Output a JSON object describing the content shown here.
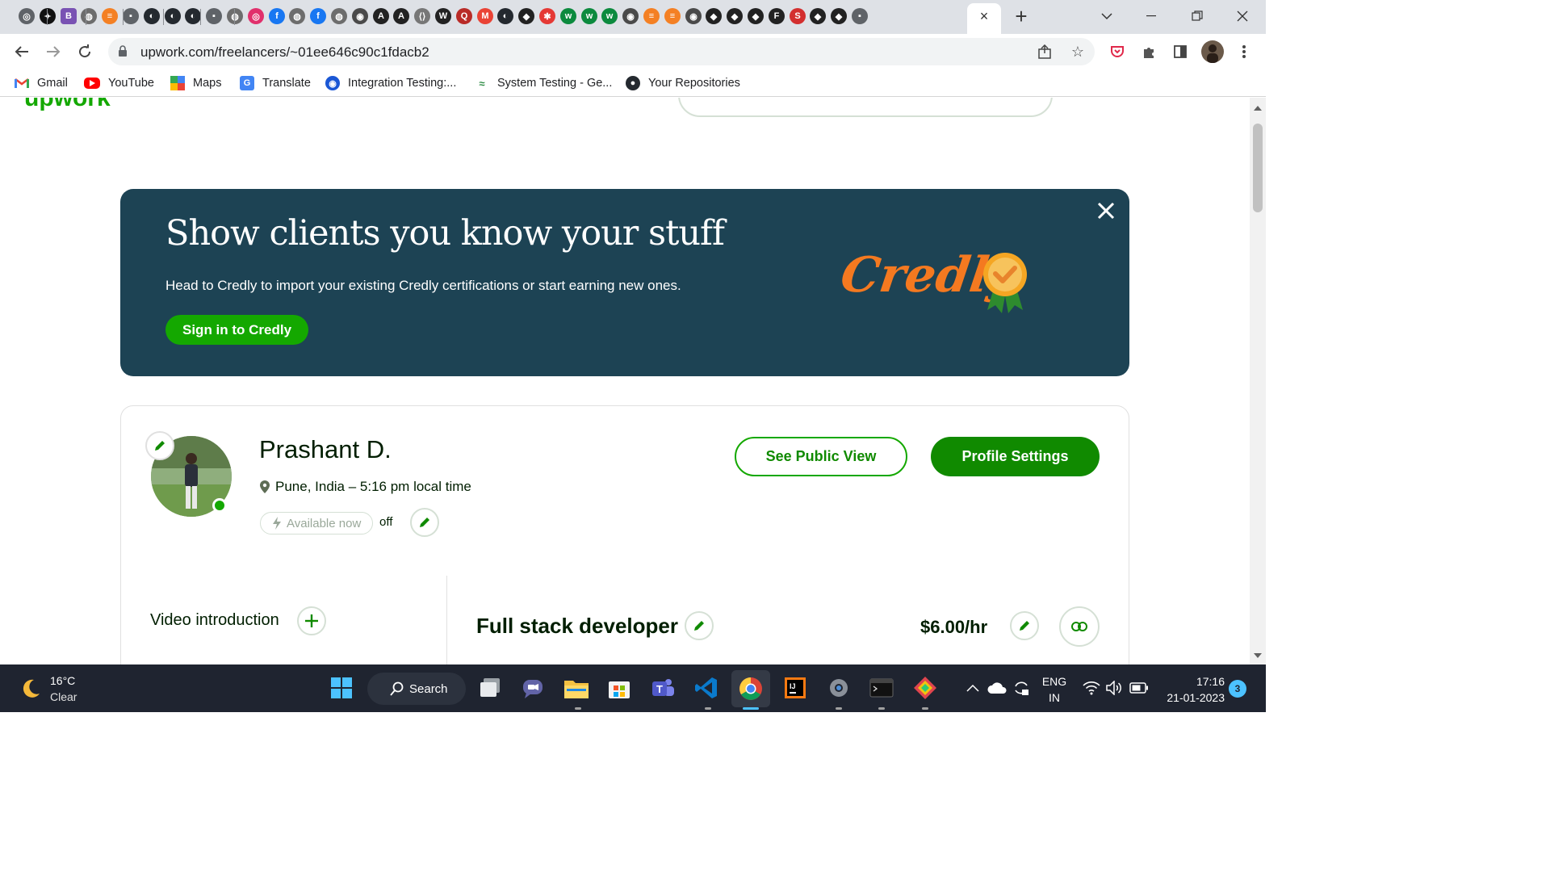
{
  "browser": {
    "tabs_favicons": [
      "generic-icon",
      "bulb-icon",
      "bootstrap-icon",
      "globe-icon",
      "stackoverflow-icon",
      "site-icon",
      "github-icon",
      "github-icon",
      "github-icon",
      "site-icon",
      "globe-icon",
      "instagram-icon",
      "facebook-icon",
      "globe-icon",
      "facebook-icon",
      "globe-icon",
      "chrome-icon",
      "angular-icon",
      "angular-icon",
      "code-icon",
      "w-icon",
      "quora-icon",
      "gmail-icon",
      "github-icon",
      "codepen-icon",
      "asterisk-icon",
      "wix-icon",
      "wix-icon",
      "wix-icon",
      "chrome-icon",
      "stackoverflow-icon",
      "stackoverflow-icon",
      "chrome-icon",
      "codepen-icon",
      "codepen-icon",
      "codepen-icon",
      "f-icon",
      "s-icon",
      "codepen-icon",
      "codepen-icon",
      "site-icon"
    ],
    "active_tab_close": "×",
    "new_tab": "+",
    "url": "upwork.com/freelancers/~01ee646c90c1fdacb2"
  },
  "bookmarks": [
    {
      "label": "Gmail",
      "icon": "gmail-icon"
    },
    {
      "label": "YouTube",
      "icon": "youtube-icon"
    },
    {
      "label": "Maps",
      "icon": "maps-icon"
    },
    {
      "label": "Translate",
      "icon": "translate-icon"
    },
    {
      "label": "Integration Testing:...",
      "icon": "site-icon"
    },
    {
      "label": "System Testing - Ge...",
      "icon": "geeks-icon"
    },
    {
      "label": "Your Repositories",
      "icon": "github-icon"
    }
  ],
  "banner": {
    "title": "Show clients you know your stuff",
    "text": "Head to Credly to import your existing Credly certifications or start earning new ones.",
    "button": "Sign in to Credly",
    "logo": "Credly"
  },
  "profile": {
    "name": "Prashant D.",
    "location": "Pune, India – 5:16 pm local time",
    "availability": "Available now",
    "availability_state": "off",
    "public_view_button": "See Public View",
    "settings_button": "Profile Settings",
    "video_intro": "Video introduction",
    "job_title": "Full stack developer",
    "rate": "$6.00/hr"
  },
  "taskbar": {
    "temperature": "16°C",
    "condition": "Clear",
    "search": "Search",
    "lang_top": "ENG",
    "lang_bottom": "IN",
    "time": "17:16",
    "date": "21-01-2023",
    "notifications": "3"
  },
  "colors": {
    "brand_green": "#14a800",
    "banner_bg": "#1d4354",
    "credly_orange": "#f47920"
  }
}
